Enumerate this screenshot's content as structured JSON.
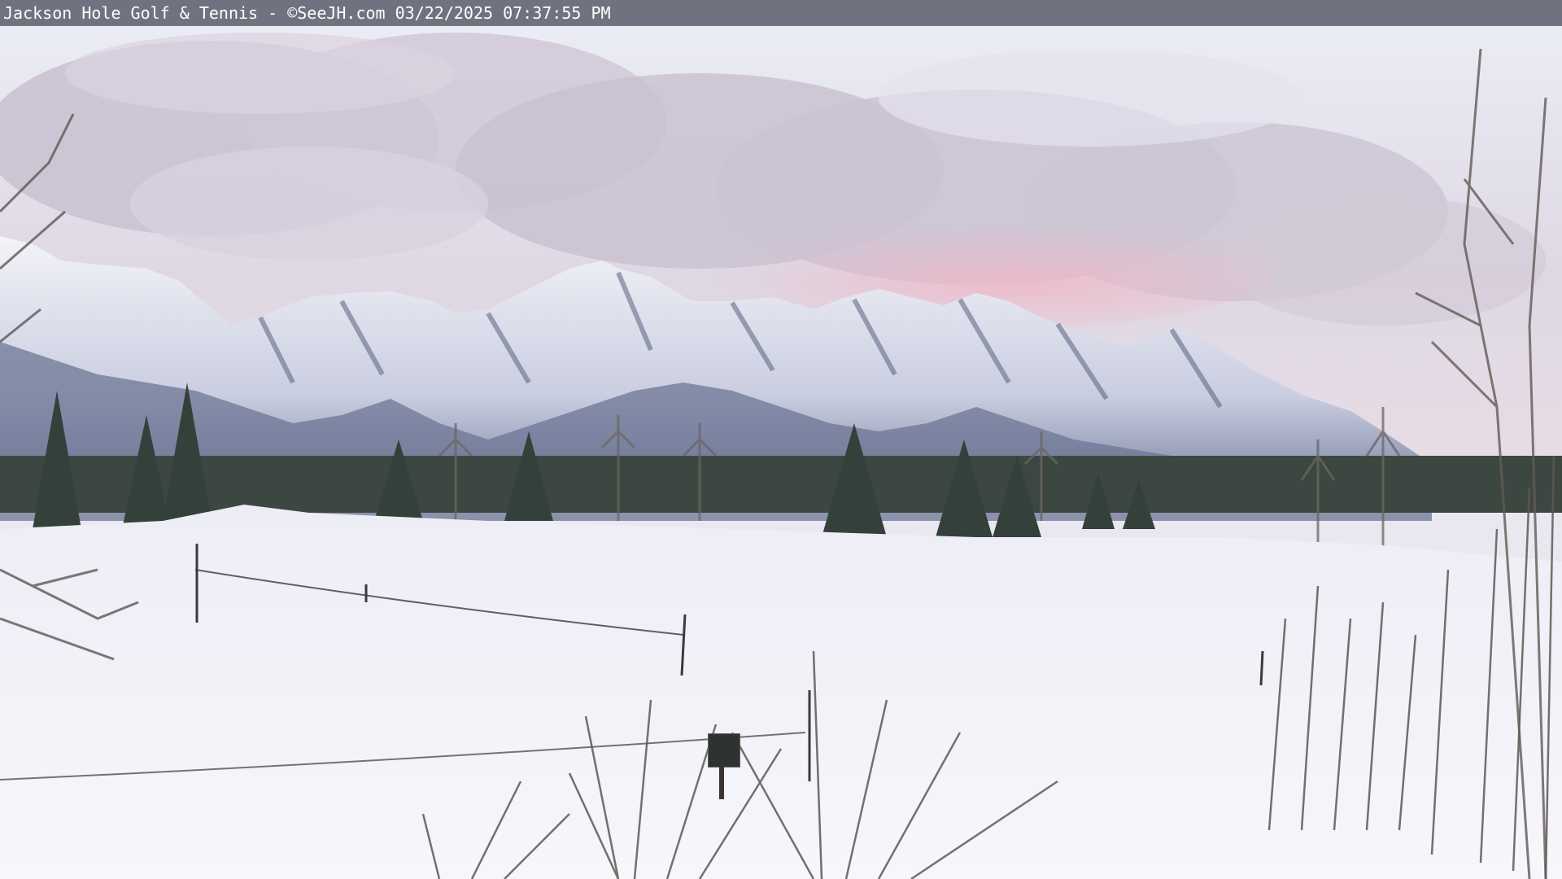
{
  "caption": {
    "text": "Jackson Hole Golf & Tennis - ©SeeJH.com 03/22/2025 07:37:55 PM"
  },
  "scene": {
    "subject": "snow-covered golf course with the Teton mountain range at dusk",
    "colors": {
      "sky_top": "#e6e8f2",
      "cloud": "#cfc7d6",
      "cloud_pink": "#e7b9c6",
      "mountain_snow": "#f1f2f8",
      "mountain_shadow": "#5c6787",
      "treeline": "#2f3a33",
      "snow_field": "#f4f3fa",
      "caption_bar": "#5f626e"
    }
  }
}
